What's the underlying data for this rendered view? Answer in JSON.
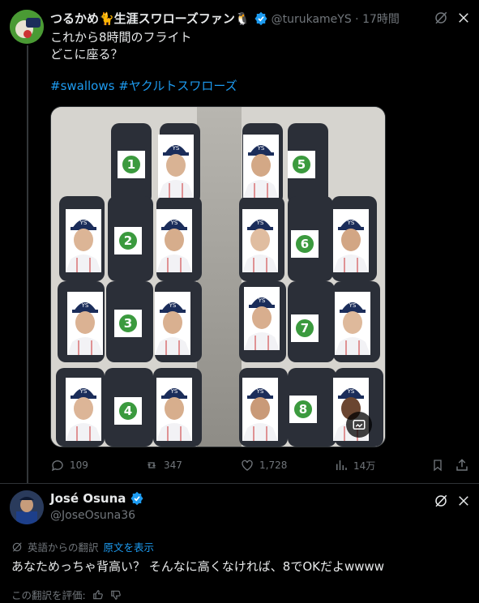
{
  "tweet": {
    "author_name": "つるかめ🐈生涯スワローズファン🐧",
    "handle_time": "@turukameYS · 17時間",
    "text_line1": "これから8時間のフライト",
    "text_line2": "どこに座る？",
    "hashtags": "#swallows #ヤクルトスワローズ",
    "seat_numbers": [
      "1",
      "2",
      "3",
      "4",
      "5",
      "6",
      "7",
      "8"
    ],
    "cap_logo": "YS",
    "actions": {
      "replies": "109",
      "retweets": "347",
      "likes": "1,728",
      "views": "14万"
    }
  },
  "reply": {
    "author_name": "José Osuna",
    "handle": "@JoseOsuna36",
    "translated_from": "英語からの翻訳",
    "show_original": "原文を表示",
    "text": "あなためっちゃ背高い？ そんなに高くなければ、8でOKだよwwww",
    "rate_translation": "この翻訳を評価:"
  },
  "colors": {
    "accent": "#1d9bf0",
    "verified": "#1d9bf0",
    "seat_green": "#3b9a3e"
  }
}
